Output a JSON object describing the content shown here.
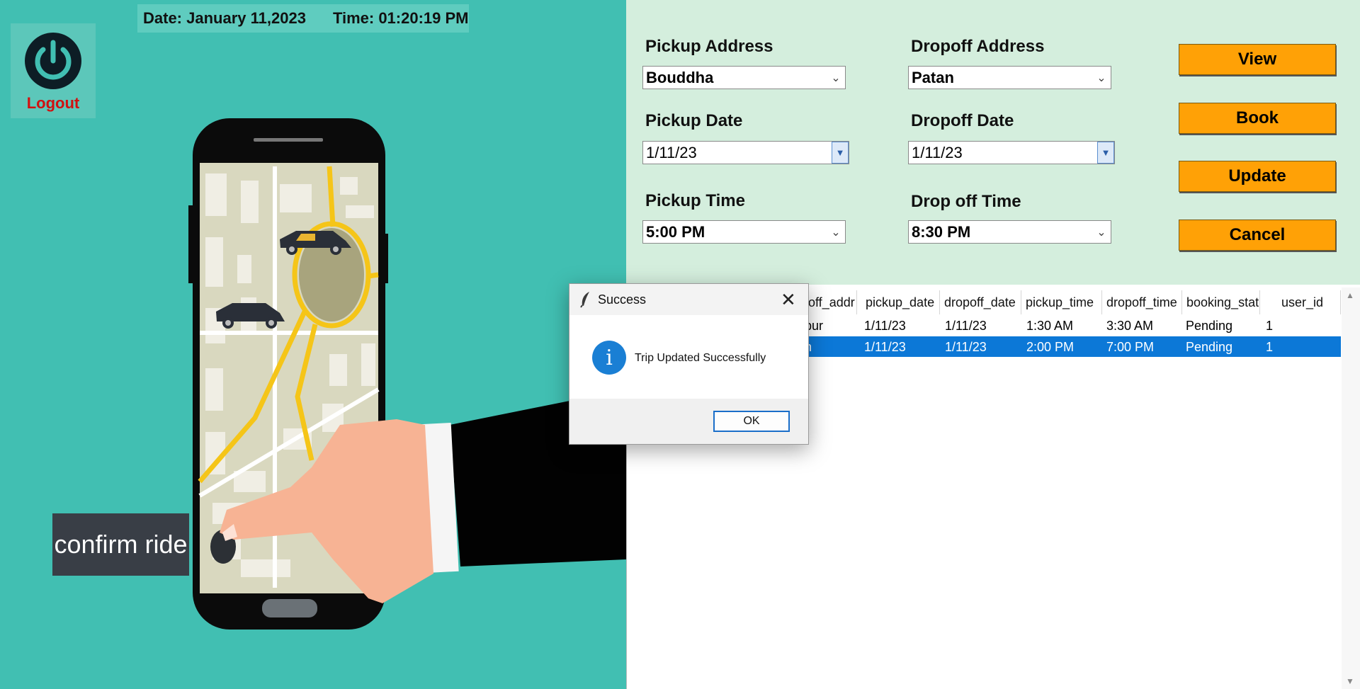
{
  "header": {
    "date_text": "Date: January 11,2023",
    "time_text": "Time: 01:20:19 PM",
    "logout_label": "Logout"
  },
  "illustration": {
    "confirm_label": "confirm ride"
  },
  "form": {
    "pickup_address": {
      "label": "Pickup Address",
      "value": "Bouddha"
    },
    "dropoff_address": {
      "label": "Dropoff Address",
      "value": "Patan"
    },
    "pickup_date": {
      "label": "Pickup Date",
      "value": "1/11/23"
    },
    "dropoff_date": {
      "label": "Dropoff Date",
      "value": "1/11/23"
    },
    "pickup_time": {
      "label": "Pickup Time",
      "value": "5:00 PM"
    },
    "dropoff_time": {
      "label": "Drop off Time",
      "value": "8:30 PM"
    }
  },
  "buttons": {
    "view": "View",
    "book": "Book",
    "update": "Update",
    "cancel": "Cancel"
  },
  "table": {
    "columns": [
      "off_addr",
      "pickup_date",
      "dropoff_date",
      "pickup_time",
      "dropoff_time",
      "booking_stat",
      "user_id"
    ],
    "rows": [
      [
        "pur",
        "1/11/23",
        "1/11/23",
        "1:30 AM",
        "3:30 AM",
        "Pending",
        "1"
      ],
      [
        "n",
        "1/11/23",
        "1/11/23",
        "2:00 PM",
        "7:00 PM",
        "Pending",
        "1"
      ]
    ],
    "selected_row": 1
  },
  "dialog": {
    "title": "Success",
    "message": "Trip Updated Successfully",
    "ok_label": "OK"
  },
  "colors": {
    "left_panel": "#41bfb2",
    "form_panel": "#d4eedd",
    "button": "#ffa106",
    "selection": "#0c78d7",
    "logout_text": "#d11010"
  }
}
